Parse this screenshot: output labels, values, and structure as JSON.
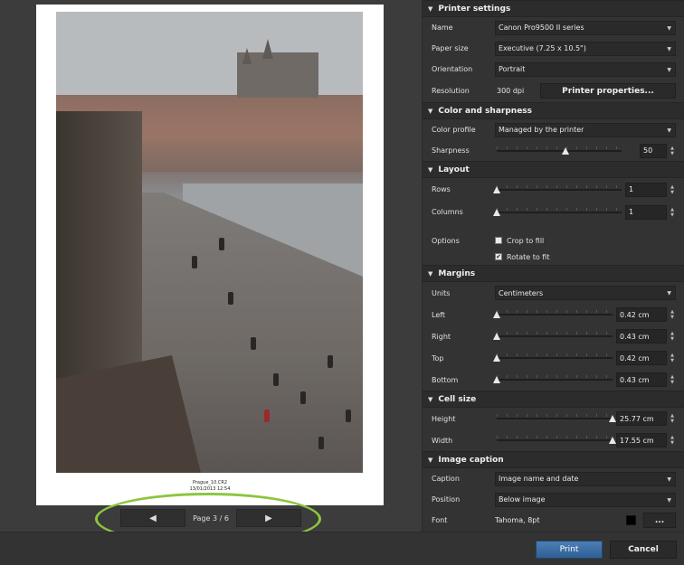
{
  "preview": {
    "caption_line1": "Prague_10.CR2",
    "caption_line2": "13/01/2013 12:54"
  },
  "page_nav": {
    "prev_glyph": "◀",
    "next_glyph": "▶",
    "indicator": "Page 3 / 6"
  },
  "printer_settings": {
    "header": "Printer settings",
    "name_label": "Name",
    "name_value": "Canon Pro9500 II series",
    "paper_size_label": "Paper size",
    "paper_size_value": "Executive (7.25 x 10.5\")",
    "orientation_label": "Orientation",
    "orientation_value": "Portrait",
    "resolution_label": "Resolution",
    "resolution_value": "300 dpi",
    "printer_properties_button": "Printer properties..."
  },
  "color_sharpness": {
    "header": "Color and sharpness",
    "color_profile_label": "Color profile",
    "color_profile_value": "Managed by the printer",
    "sharpness_label": "Sharpness",
    "sharpness_value": "50"
  },
  "layout": {
    "header": "Layout",
    "rows_label": "Rows",
    "rows_value": "1",
    "columns_label": "Columns",
    "columns_value": "1",
    "options_label": "Options",
    "crop_to_fill_label": "Crop to fill",
    "crop_to_fill_checked": false,
    "rotate_to_fit_label": "Rotate to fit",
    "rotate_to_fit_checked": true,
    "check_glyph": "✔"
  },
  "margins": {
    "header": "Margins",
    "units_label": "Units",
    "units_value": "Centimeters",
    "left_label": "Left",
    "left_value": "0.42 cm",
    "right_label": "Right",
    "right_value": "0.43 cm",
    "top_label": "Top",
    "top_value": "0.42 cm",
    "bottom_label": "Bottom",
    "bottom_value": "0.43 cm"
  },
  "cell_size": {
    "header": "Cell size",
    "height_label": "Height",
    "height_value": "25.77 cm",
    "width_label": "Width",
    "width_value": "17.55 cm"
  },
  "image_caption": {
    "header": "Image caption",
    "caption_label": "Caption",
    "caption_value": "Image name and date",
    "position_label": "Position",
    "position_value": "Below image",
    "font_label": "Font",
    "font_value": "Tahoma, 8pt",
    "font_color": "#000000",
    "font_button": "..."
  },
  "dialog": {
    "print_button": "Print",
    "cancel_button": "Cancel"
  },
  "icons": {
    "collapse": "▼",
    "dropdown": "▼",
    "spin_up": "▲",
    "spin_down": "▼"
  }
}
